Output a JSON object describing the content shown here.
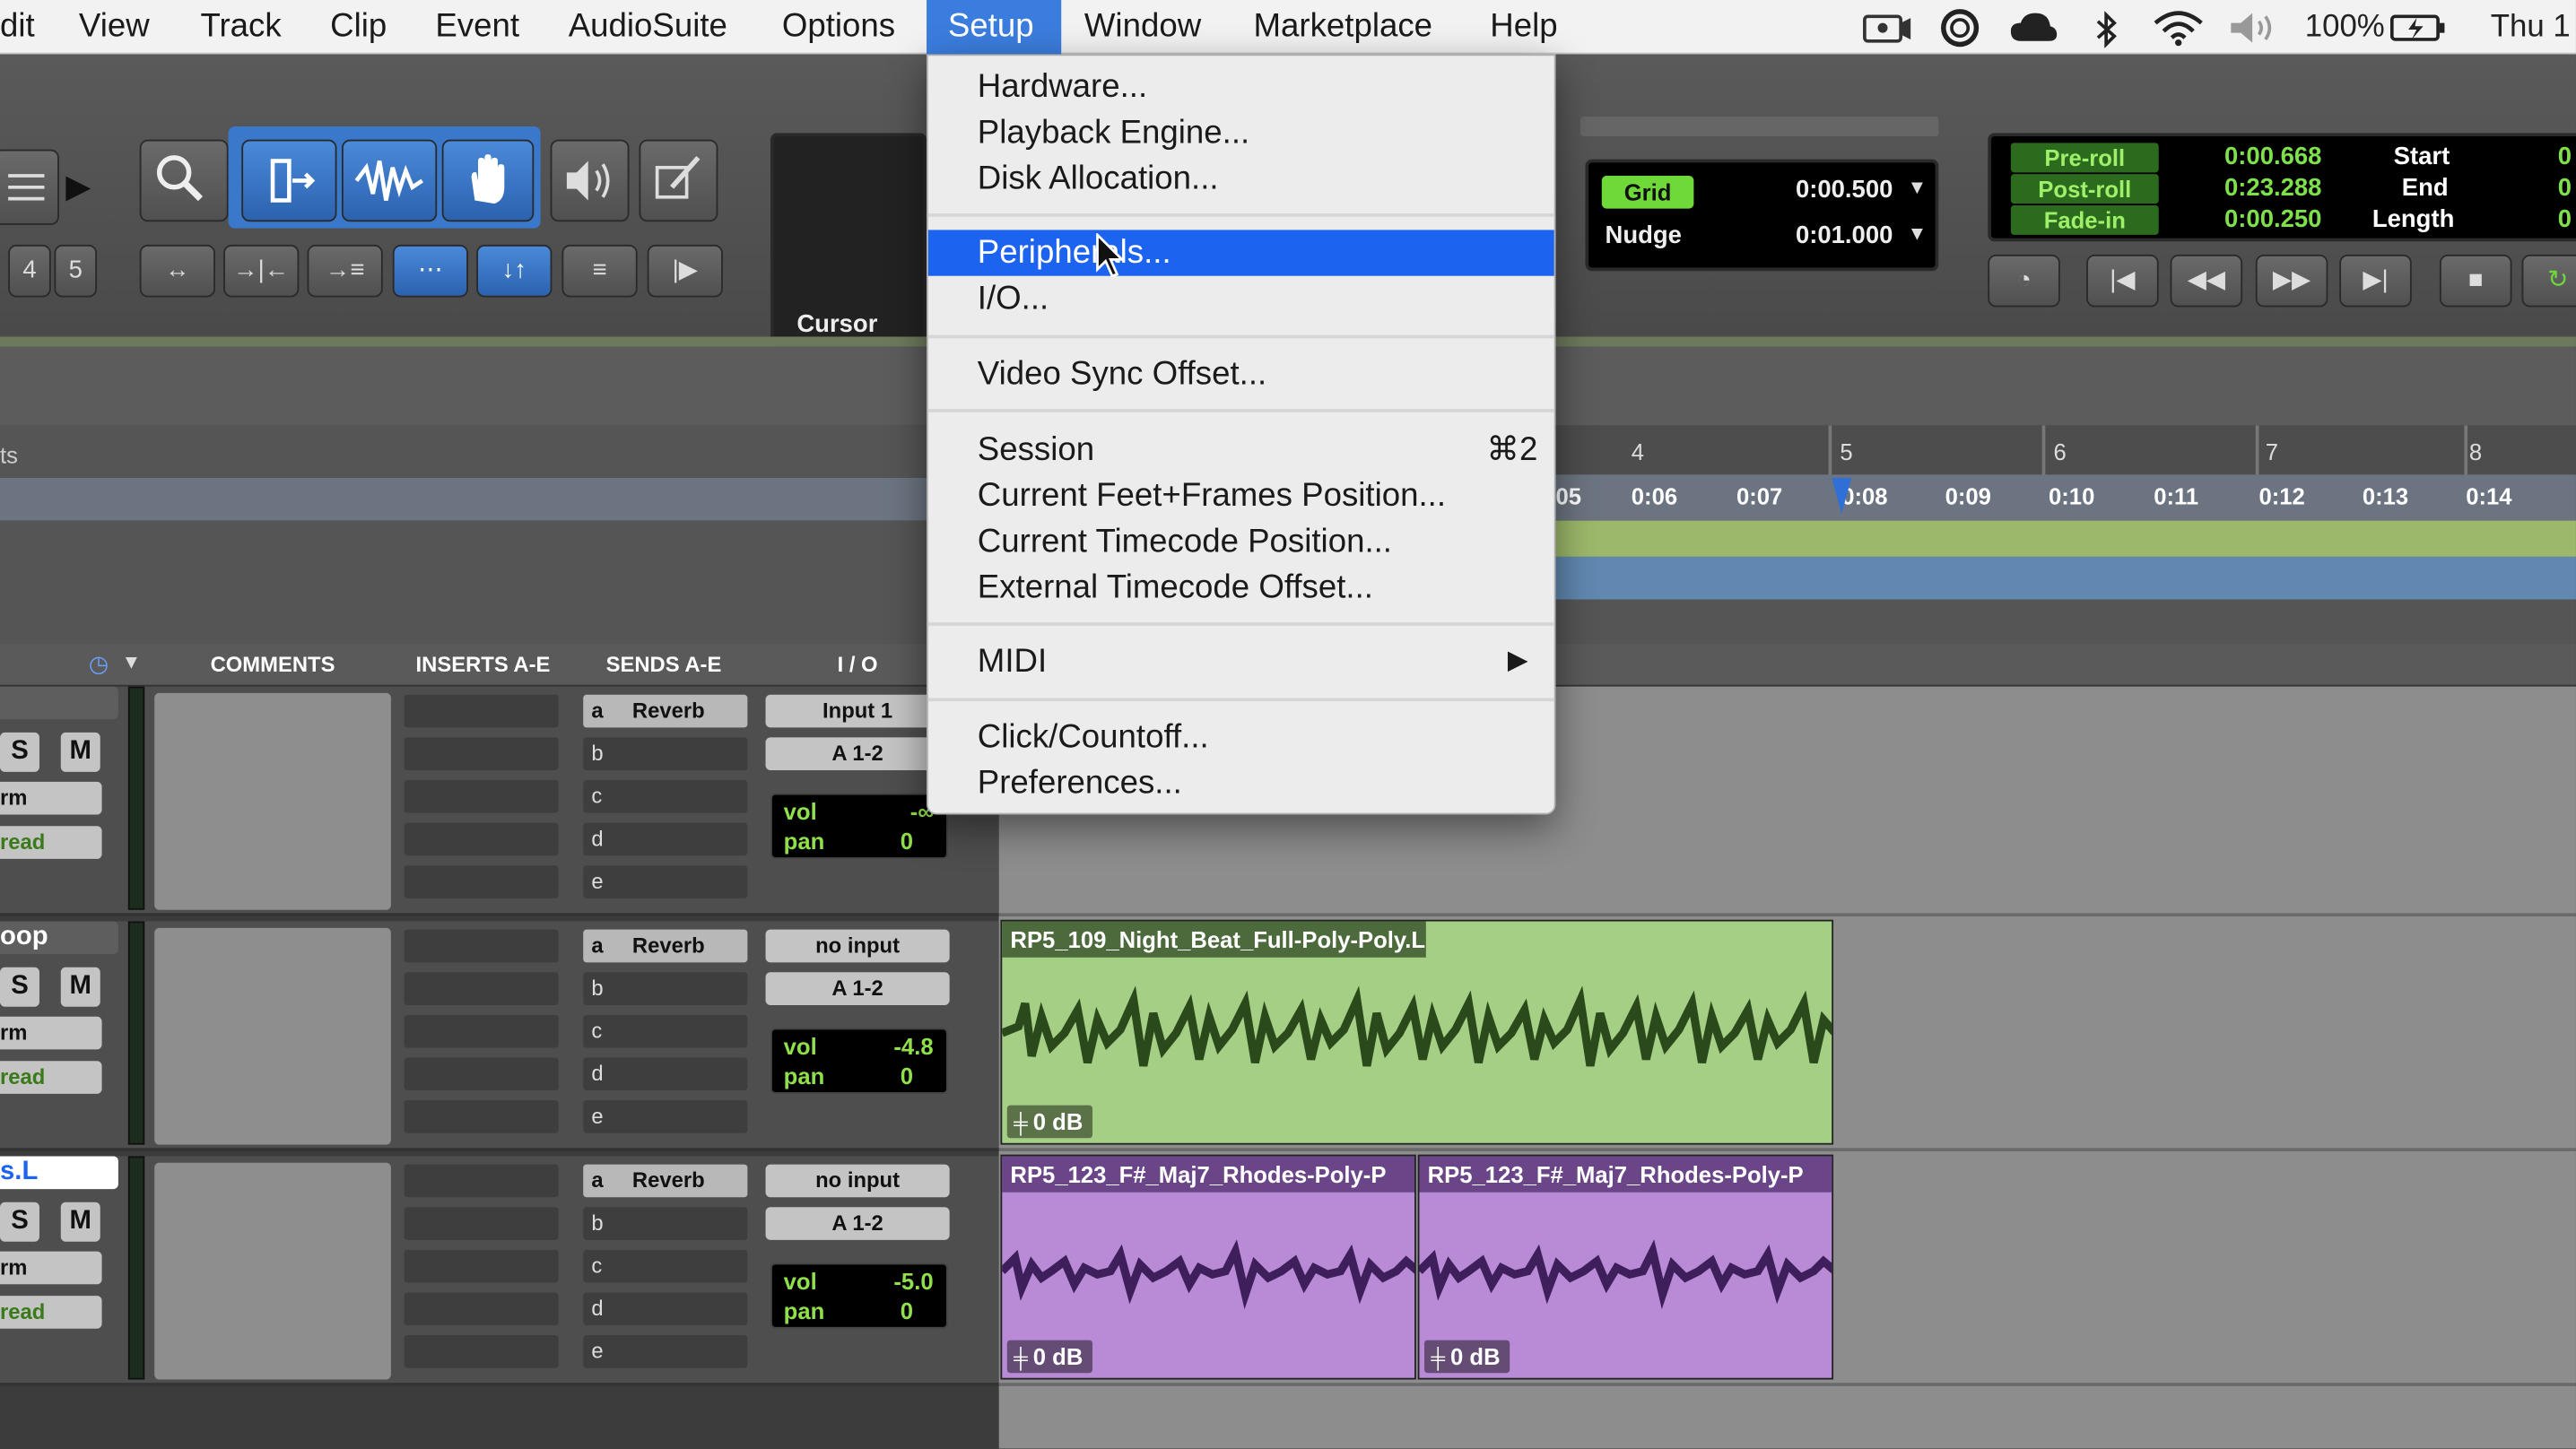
{
  "menubar": {
    "items": [
      "dit",
      "View",
      "Track",
      "Clip",
      "Event",
      "AudioSuite",
      "Options",
      "Setup",
      "Window",
      "Marketplace",
      "Help"
    ],
    "active": "Setup",
    "battery": "100%",
    "clock": "Thu 1"
  },
  "setup_menu": {
    "items": [
      "Hardware...",
      "Playback Engine...",
      "Disk Allocation...",
      "Peripherals...",
      "I/O...",
      "Video Sync Offset...",
      "Session",
      "Current Feet+Frames Position...",
      "Current Timecode Position...",
      "External Timecode Offset...",
      "MIDI",
      "Click/Countoff...",
      "Preferences..."
    ],
    "highlighted": "Peripherals...",
    "session_shortcut": "⌘2"
  },
  "toolbar": {
    "zoom_presets": [
      "4",
      "5"
    ],
    "cursor_label": "Cursor",
    "grid_label": "Grid",
    "grid_value": "0:00.500",
    "nudge_label": "Nudge",
    "nudge_value": "0:01.000",
    "preroll_label": "Pre-roll",
    "preroll_value": "0:00.668",
    "postroll_label": "Post-roll",
    "postroll_value": "0:23.288",
    "fadein_label": "Fade-in",
    "fadein_value": "0:00.250",
    "start_label": "Start",
    "end_label": "End",
    "length_label": "Length",
    "start_value": "0",
    "end_value": "0",
    "length_value": "0"
  },
  "ruler": {
    "left_label": "ts",
    "bars": [
      "4",
      "5",
      "6",
      "7",
      "8"
    ],
    "times": [
      "05",
      "0:06",
      "0:07",
      "0:08",
      "0:09",
      "0:10",
      "0:11",
      "0:12",
      "0:13",
      "0:14"
    ]
  },
  "columns": {
    "comments": "COMMENTS",
    "inserts": "INSERTS A-E",
    "sends": "SENDS A-E",
    "io": "I / O"
  },
  "tracks": [
    {
      "name": "",
      "solo": "S",
      "mute": "M",
      "rec_mode": "rm",
      "automation": "read",
      "send_a": "Reverb",
      "send_letters": [
        "a",
        "b",
        "c",
        "d",
        "e"
      ],
      "input": "Input 1",
      "output": "A 1-2",
      "vol_label": "vol",
      "vol": "-∞",
      "pan_label": "pan",
      "pan": "0"
    },
    {
      "name": "oop",
      "solo": "S",
      "mute": "M",
      "rec_mode": "rm",
      "automation": "read",
      "send_a": "Reverb",
      "send_letters": [
        "a",
        "b",
        "c",
        "d",
        "e"
      ],
      "input": "no input",
      "output": "A 1-2",
      "vol_label": "vol",
      "vol": "-4.8",
      "pan_label": "pan",
      "pan": "0"
    },
    {
      "name": "s.L",
      "solo": "S",
      "mute": "M",
      "rec_mode": "rm",
      "automation": "read",
      "send_a": "Reverb",
      "send_letters": [
        "a",
        "b",
        "c",
        "d",
        "e"
      ],
      "input": "no input",
      "output": "A 1-2",
      "vol_label": "vol",
      "vol": "-5.0",
      "pan_label": "pan",
      "pan": "0"
    }
  ],
  "clips": [
    {
      "name": "RP5_109_Night_Beat_Full-Poly-Poly.L",
      "gain": "0 dB",
      "color": "#a6cf86"
    },
    {
      "name": "RP5_123_F#_Maj7_Rhodes-Poly-P",
      "gain": "0 dB",
      "color": "#b98bd6"
    },
    {
      "name": "RP5_123_F#_Maj7_Rhodes-Poly-P",
      "gain": "0 dB",
      "color": "#b98bd6"
    }
  ],
  "colors": {
    "menu_highlight": "#1c63f0",
    "counter_green": "#7ee04b",
    "toolbar_blue": "#3a78cc"
  }
}
